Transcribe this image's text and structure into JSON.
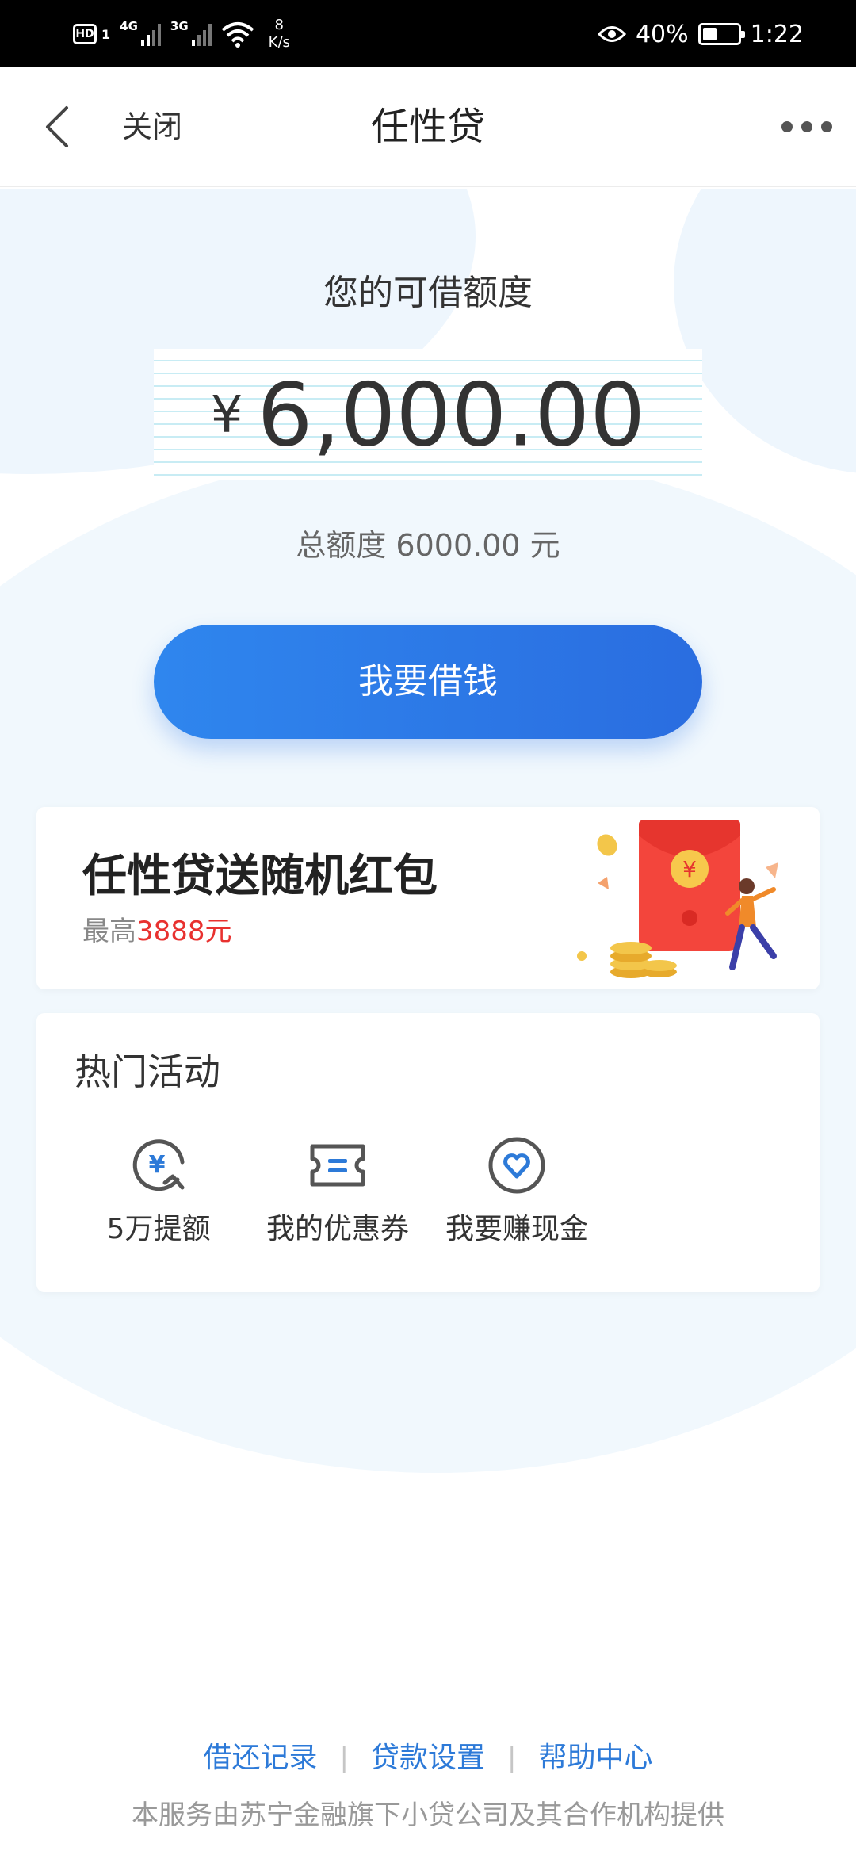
{
  "status_bar": {
    "hd": "HD",
    "sim": "1",
    "net1": "4G",
    "net2": "3G",
    "speed_value": "8",
    "speed_unit": "K/s",
    "battery": "40%",
    "battery_level": 0.4,
    "time": "1:22"
  },
  "nav": {
    "close_label": "关闭",
    "title": "任性贷"
  },
  "quota": {
    "label": "您的可借额度",
    "currency": "¥",
    "amount": "6,000.00",
    "total_text": "总额度 6000.00 元"
  },
  "borrow_button": "我要借钱",
  "promo": {
    "title": "任性贷送随机红包",
    "sub_prefix": "最高",
    "sub_amount": "3888元"
  },
  "hot": {
    "title": "热门活动",
    "items": [
      {
        "label": "5万提额",
        "icon": "yen-raise-icon"
      },
      {
        "label": "我的优惠券",
        "icon": "coupon-icon"
      },
      {
        "label": "我要赚现金",
        "icon": "heart-circle-icon"
      }
    ]
  },
  "footer": {
    "links": [
      "借还记录",
      "贷款设置",
      "帮助中心"
    ],
    "note": "本服务由苏宁金融旗下小贷公司及其合作机构提供"
  },
  "colors": {
    "accent": "#2d7ad8",
    "button": "#2f86ee",
    "promo_red": "#e8312f",
    "bg_blob": "#eef6fd"
  }
}
